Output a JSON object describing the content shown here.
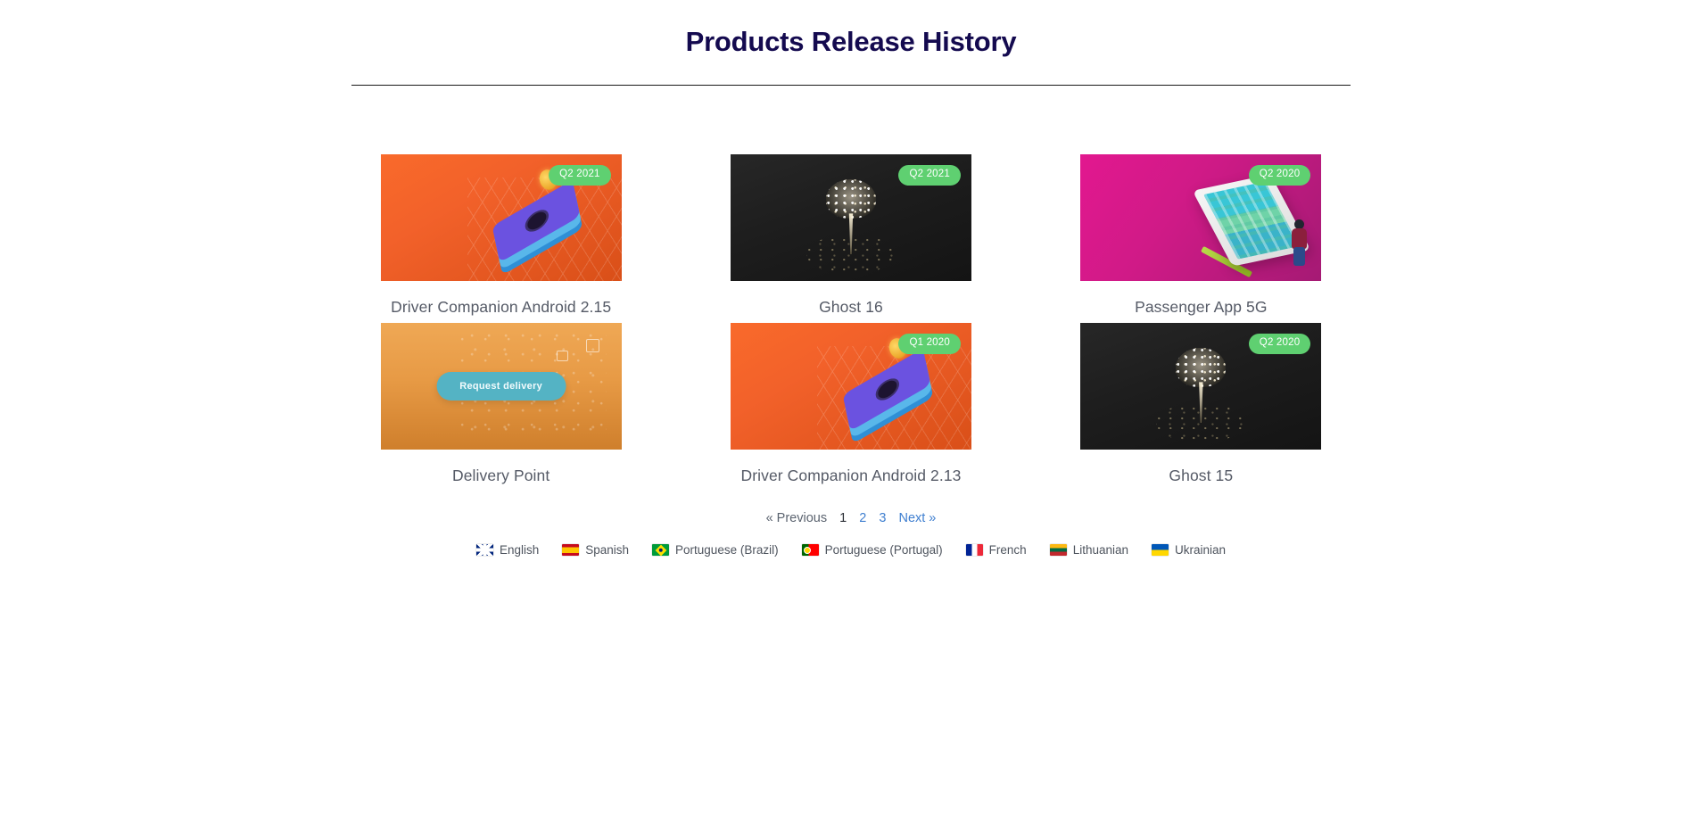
{
  "header": {
    "title": "Products Release History"
  },
  "products": [
    {
      "title": "Driver Companion Android 2.15",
      "badge": "Q2 2021",
      "art": "orange-phone",
      "art_class": "art-orange"
    },
    {
      "title": "Ghost 16",
      "badge": "Q2 2021",
      "art": "dark-burst",
      "art_class": "art-dark"
    },
    {
      "title": "Passenger App 5G",
      "badge": "Q2 2020",
      "art": "magenta-tablet",
      "art_class": "art-magenta"
    },
    {
      "title": "Delivery Point",
      "badge": "",
      "art": "tan-delivery",
      "art_class": "art-tan",
      "button_label": "Request delivery"
    },
    {
      "title": "Driver Companion Android 2.13",
      "badge": "Q1 2020",
      "art": "orange-phone",
      "art_class": "art-orange"
    },
    {
      "title": "Ghost 15",
      "badge": "Q2 2020",
      "art": "dark-burst",
      "art_class": "art-dark"
    }
  ],
  "pagination": {
    "previous": "« Previous",
    "pages": [
      "1",
      "2",
      "3"
    ],
    "current_page": "1",
    "next": "Next »"
  },
  "languages": [
    {
      "name": "English",
      "flag": "flag-gb",
      "icon": "flag-united-kingdom-icon"
    },
    {
      "name": "Spanish",
      "flag": "flag-es",
      "icon": "flag-spain-icon"
    },
    {
      "name": "Portuguese (Brazil)",
      "flag": "flag-br",
      "icon": "flag-brazil-icon"
    },
    {
      "name": "Portuguese (Portugal)",
      "flag": "flag-pt",
      "icon": "flag-portugal-icon"
    },
    {
      "name": "French",
      "flag": "flag-fr",
      "icon": "flag-france-icon"
    },
    {
      "name": "Lithuanian",
      "flag": "flag-lt",
      "icon": "flag-lithuania-icon"
    },
    {
      "name": "Ukrainian",
      "flag": "flag-ua",
      "icon": "flag-ukraine-icon"
    }
  ],
  "colors": {
    "title": "#140a4f",
    "badge_green": "#5fd071",
    "card_title": "#555a66",
    "link_blue": "#3f7fd0",
    "delivery_button": "#54b3c4"
  }
}
